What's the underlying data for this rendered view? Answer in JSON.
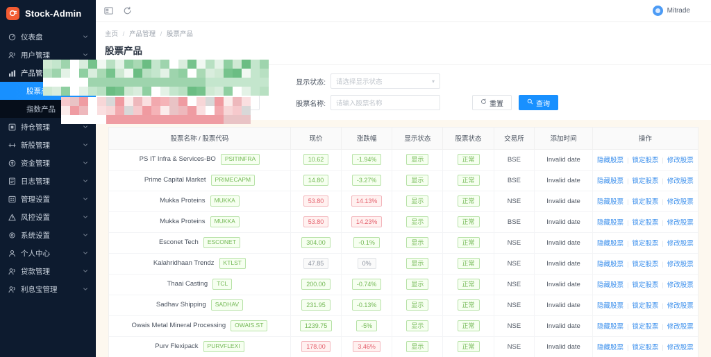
{
  "brand": {
    "name": "Stock-Admin",
    "logo_icon": "orange-rounded-logo-icon",
    "accent": "#f25b32"
  },
  "sidebar": {
    "items": [
      {
        "label": "仪表盘",
        "icon": "dashboard-icon",
        "expandable": true
      },
      {
        "label": "用户管理",
        "icon": "users-icon",
        "expandable": true
      },
      {
        "label": "产品管理",
        "icon": "chart-bar-icon",
        "expandable": true,
        "expanded": true
      },
      {
        "label": "持仓管理",
        "icon": "position-icon",
        "expandable": true
      },
      {
        "label": "新股管理",
        "icon": "ipo-icon",
        "expandable": true
      },
      {
        "label": "资金管理",
        "icon": "coin-icon",
        "expandable": true
      },
      {
        "label": "日志管理",
        "icon": "log-icon",
        "expandable": true
      },
      {
        "label": "管理设置",
        "icon": "admin-settings-icon",
        "expandable": true
      },
      {
        "label": "风控设置",
        "icon": "warning-triangle-icon",
        "expandable": true
      },
      {
        "label": "系统设置",
        "icon": "gear-icon",
        "expandable": true
      },
      {
        "label": "个人中心",
        "icon": "person-icon",
        "expandable": true
      },
      {
        "label": "贷款管理",
        "icon": "loan-icon",
        "expandable": true
      },
      {
        "label": "利息宝管理",
        "icon": "interest-icon",
        "expandable": true
      }
    ],
    "sub_items": [
      {
        "label": "股票产品",
        "active": true
      },
      {
        "label": "指数产品",
        "active": false
      }
    ]
  },
  "topbar": {
    "collapse_icon": "menu-collapse-icon",
    "refresh_icon": "refresh-icon",
    "user_name": "Mitrade",
    "avatar_icon": "user-avatar-icon"
  },
  "breadcrumb": {
    "home": "主页",
    "section": "产品管理",
    "current": "股票产品"
  },
  "page_title": "股票产品",
  "filters": {
    "show_status": {
      "label": "显示状态:",
      "placeholder": "请选择显示状态",
      "value": "",
      "caret_icon": "chevron-down-icon"
    },
    "stock_name": {
      "label": "股票名称:",
      "placeholder": "请输入股票名称",
      "value": ""
    },
    "reset_button": {
      "label": "重置",
      "icon": "reset-circle-icon"
    },
    "search_button": {
      "label": "查询",
      "icon": "search-icon"
    }
  },
  "table": {
    "columns": [
      "股票名称 / 股票代码",
      "现价",
      "涨跌幅",
      "显示状态",
      "股票状态",
      "交易所",
      "添加时间",
      "操作"
    ],
    "actions": {
      "hide": "隐藏股票",
      "lock": "锁定股票",
      "edit": "修改股票",
      "separator": "|"
    },
    "rows": [
      {
        "name": "PS IT Infra & Services-BO",
        "code": "PSITINFRA",
        "price": "10.62",
        "price_tone": "green",
        "change": "-1.94%",
        "change_tone": "green",
        "show_status": "显示",
        "stock_status": "正常",
        "exchange": "BSE",
        "added": "Invalid date"
      },
      {
        "name": "Prime Capital Market",
        "code": "PRIMECAPM",
        "price": "14.80",
        "price_tone": "green",
        "change": "-3.27%",
        "change_tone": "green",
        "show_status": "显示",
        "stock_status": "正常",
        "exchange": "BSE",
        "added": "Invalid date"
      },
      {
        "name": "Mukka Proteins",
        "code": "MUKKA",
        "price": "53.80",
        "price_tone": "red",
        "change": "14.13%",
        "change_tone": "red",
        "show_status": "显示",
        "stock_status": "正常",
        "exchange": "NSE",
        "added": "Invalid date"
      },
      {
        "name": "Mukka Proteins",
        "code": "MUKKA",
        "price": "53.80",
        "price_tone": "red",
        "change": "14.23%",
        "change_tone": "red",
        "show_status": "显示",
        "stock_status": "正常",
        "exchange": "BSE",
        "added": "Invalid date"
      },
      {
        "name": "Esconet Tech",
        "code": "ESCONET",
        "price": "304.00",
        "price_tone": "green",
        "change": "-0.1%",
        "change_tone": "green",
        "show_status": "显示",
        "stock_status": "正常",
        "exchange": "NSE",
        "added": "Invalid date"
      },
      {
        "name": "Kalahridhaan Trendz",
        "code": "KTLST",
        "price": "47.85",
        "price_tone": "gray",
        "change": "0%",
        "change_tone": "gray",
        "show_status": "显示",
        "stock_status": "正常",
        "exchange": "NSE",
        "added": "Invalid date"
      },
      {
        "name": "Thaai Casting",
        "code": "TCL",
        "price": "200.00",
        "price_tone": "green",
        "change": "-0.74%",
        "change_tone": "green",
        "show_status": "显示",
        "stock_status": "正常",
        "exchange": "NSE",
        "added": "Invalid date"
      },
      {
        "name": "Sadhav Shipping",
        "code": "SADHAV",
        "price": "231.95",
        "price_tone": "green",
        "change": "-0.13%",
        "change_tone": "green",
        "show_status": "显示",
        "stock_status": "正常",
        "exchange": "NSE",
        "added": "Invalid date"
      },
      {
        "name": "Owais Metal Mineral Processing",
        "code": "OWAIS.ST",
        "price": "1239.75",
        "price_tone": "green",
        "change": "-5%",
        "change_tone": "green",
        "show_status": "显示",
        "stock_status": "正常",
        "exchange": "NSE",
        "added": "Invalid date"
      },
      {
        "name": "Purv Flexipack",
        "code": "PURVFLEXI",
        "price": "178.00",
        "price_tone": "red",
        "change": "3.46%",
        "change_tone": "red",
        "show_status": "显示",
        "stock_status": "正常",
        "exchange": "NSE",
        "added": "Invalid date"
      }
    ]
  },
  "colors": {
    "sidebar_bg": "#0d1b2f",
    "active_nav": "#1890ff",
    "primary_button": "#1890ff",
    "cream_panel": "#fdf8ef",
    "green_tag": "#73b855",
    "red_tag": "#e4606d"
  }
}
